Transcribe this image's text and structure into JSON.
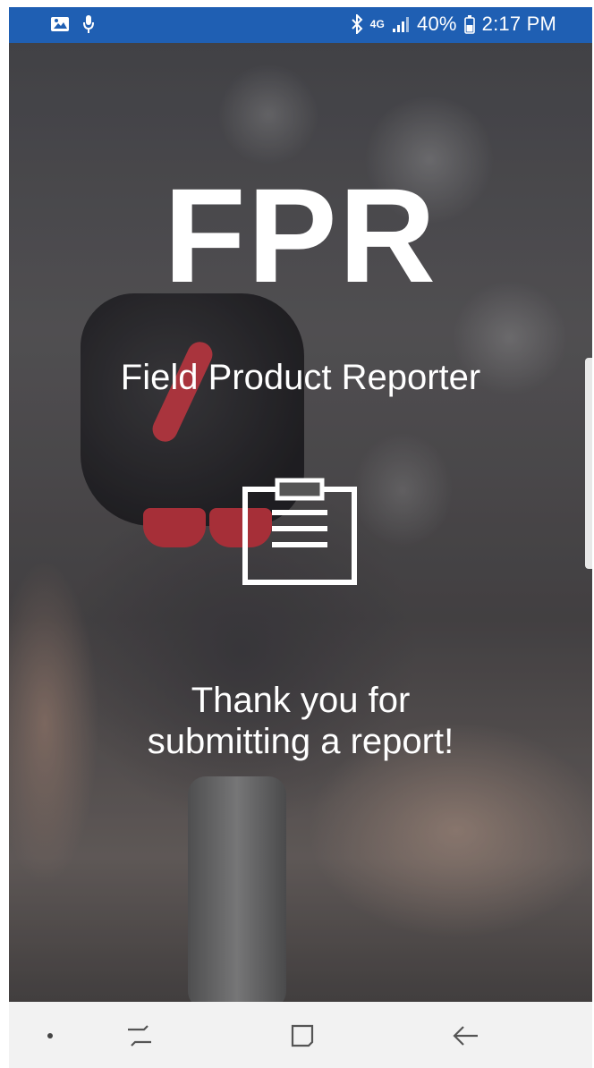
{
  "status_bar": {
    "left_icons": [
      "gallery-icon",
      "microphone-icon"
    ],
    "right_icons": [
      "bluetooth-icon",
      "network-4g-icon",
      "signal-icon",
      "battery-icon"
    ],
    "network_label": "4G",
    "battery_percent": "40%",
    "time": "2:17 PM",
    "background_color": "#1f5fb3"
  },
  "hero": {
    "title": "FPR",
    "subtitle": "Field Product Reporter",
    "icon": "clipboard-icon",
    "message_line1": "Thank you for",
    "message_line2": "submitting a report!"
  },
  "nav_bar": {
    "items": [
      "nav-dot-icon",
      "recent-apps-icon",
      "home-icon",
      "back-icon"
    ]
  }
}
